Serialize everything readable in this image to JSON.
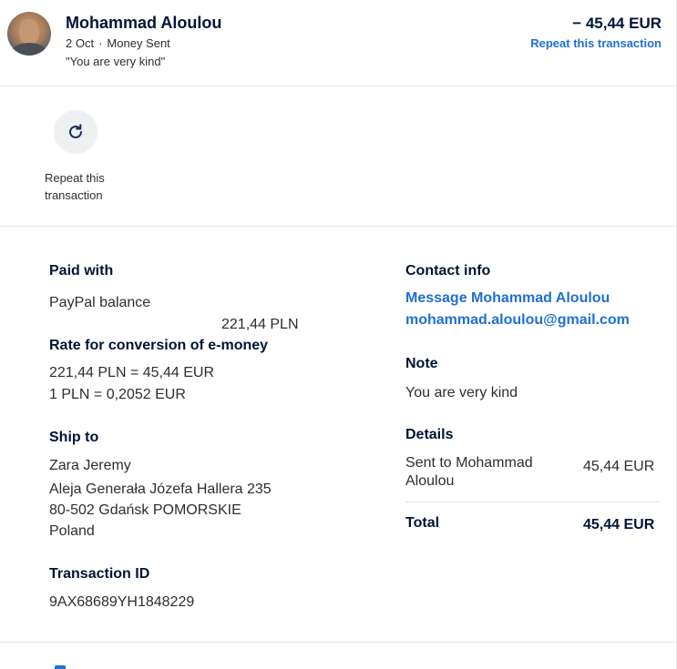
{
  "header": {
    "name": "Mohammad Aloulou",
    "date": "2 Oct",
    "separator": "·",
    "type": "Money Sent",
    "note_quote": "\"You are very kind\"",
    "amount": "− 45,44 EUR",
    "repeat_link": "Repeat this transaction"
  },
  "actions": {
    "repeat_line1": "Repeat this",
    "repeat_line2": "transaction",
    "icon": "refresh-icon"
  },
  "paid_with": {
    "heading": "Paid with",
    "method": "PayPal balance",
    "amount": "221,44 PLN"
  },
  "conversion": {
    "heading": "Rate for conversion of e-money",
    "line1": "221,44 PLN = 45,44 EUR",
    "line2": "1 PLN = 0,2052 EUR"
  },
  "ship_to": {
    "heading": "Ship to",
    "name": "Zara Jeremy",
    "street": "Aleja Generała Józefa Hallera 235",
    "city": "80-502 Gdańsk POMORSKIE",
    "country": "Poland"
  },
  "transaction": {
    "heading": "Transaction ID",
    "id": "9AX68689YH1848229"
  },
  "contact": {
    "heading": "Contact info",
    "message_link": "Message Mohammad Aloulou",
    "email": "mohammad.aloulou@gmail.com"
  },
  "note": {
    "heading": "Note",
    "text": "You are very kind"
  },
  "details": {
    "heading": "Details",
    "sent_line1": "Sent to Mohammad",
    "sent_line2": "Aloulou",
    "sent_amount": "45,44 EUR",
    "total_label": "Total",
    "total_amount": "45,44 EUR"
  },
  "colors": {
    "link": "#1f6fd6",
    "text": "#001435"
  }
}
